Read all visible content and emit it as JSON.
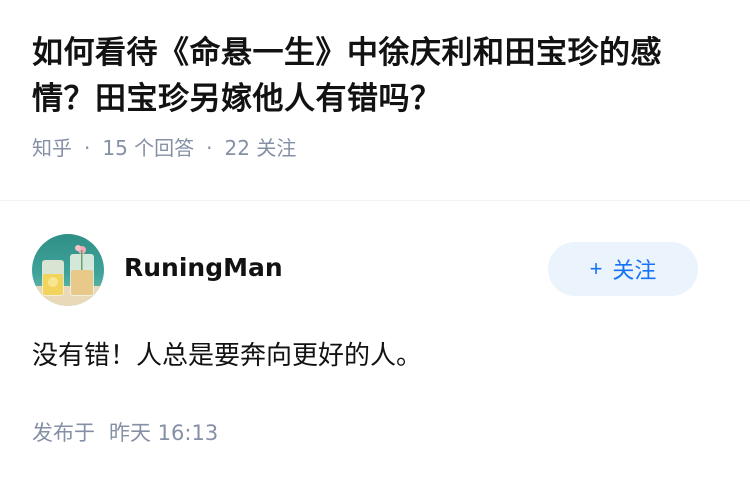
{
  "question": {
    "title": "如何看待《命悬一生》中徐庆利和田宝珍的感情？田宝珍另嫁他人有错吗？",
    "source": "知乎",
    "answers_count": "15 个回答",
    "followers_count": "22 关注"
  },
  "answer": {
    "author_name": "RuningMan",
    "follow_label": "关注",
    "content": "没有错！人总是要奔向更好的人。",
    "published_label": "发布于",
    "published_time": "昨天 16:13"
  },
  "colors": {
    "meta_text": "#8590a6",
    "follow_bg": "#ebf3fd",
    "follow_text": "#1772f6",
    "divider": "#f0f2f7"
  }
}
